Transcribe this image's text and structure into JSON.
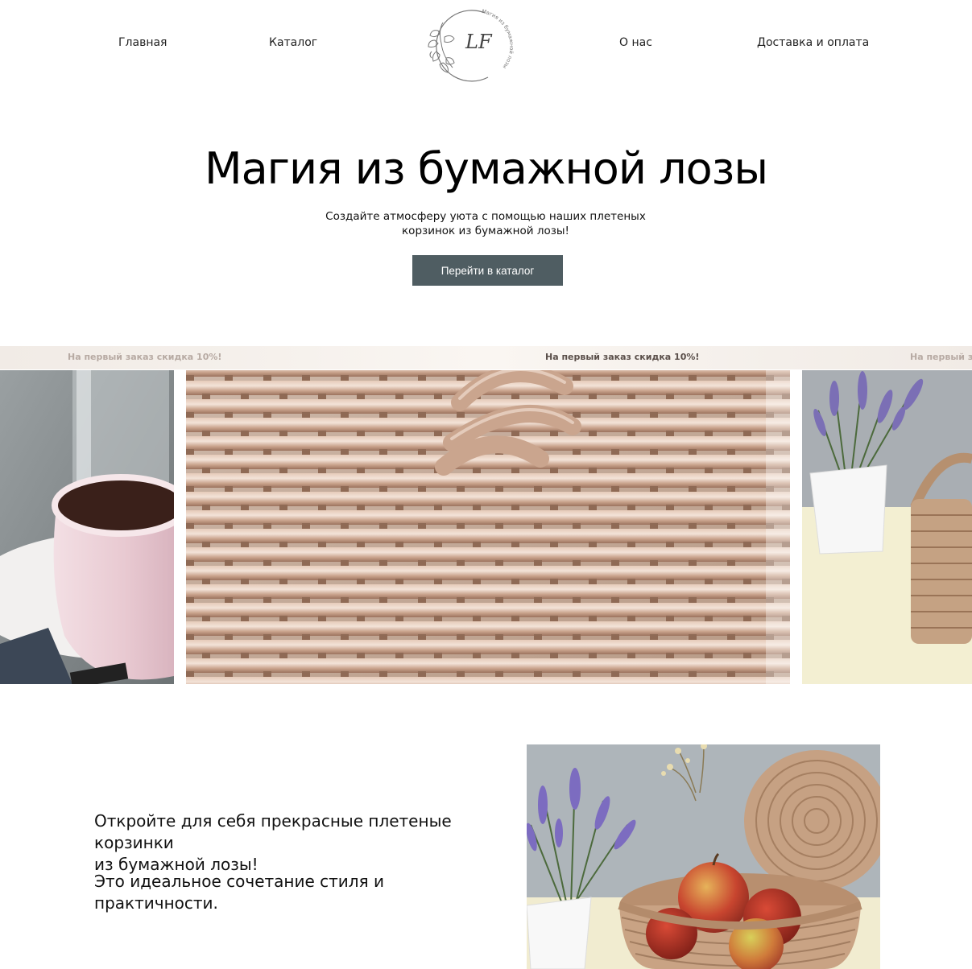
{
  "nav": {
    "home": "Главная",
    "catalog": "Каталог",
    "about": "О нас",
    "delivery": "Доставка и оплата"
  },
  "logo": {
    "monogram": "LF",
    "circle_text": "Магия из бумажной лозы"
  },
  "hero": {
    "title": "Магия из бумажной лозы",
    "subtitle_line1": "Создайте атмосферу уюта с помощью наших плетеных",
    "subtitle_line2": "корзинок из бумажной лозы!",
    "cta": "Перейти в каталог"
  },
  "promo": {
    "text": "На первый заказ скидка 10%!"
  },
  "about": {
    "line1": "Откройте для себя прекрасные плетеные корзинки",
    "line2": "из бумажной лозы!",
    "line3": "Это идеальное сочетание стиля и практичности."
  },
  "colors": {
    "button": "#4f5d62",
    "marquee_bg": "#f4efea",
    "wicker": "#c9a38c"
  }
}
